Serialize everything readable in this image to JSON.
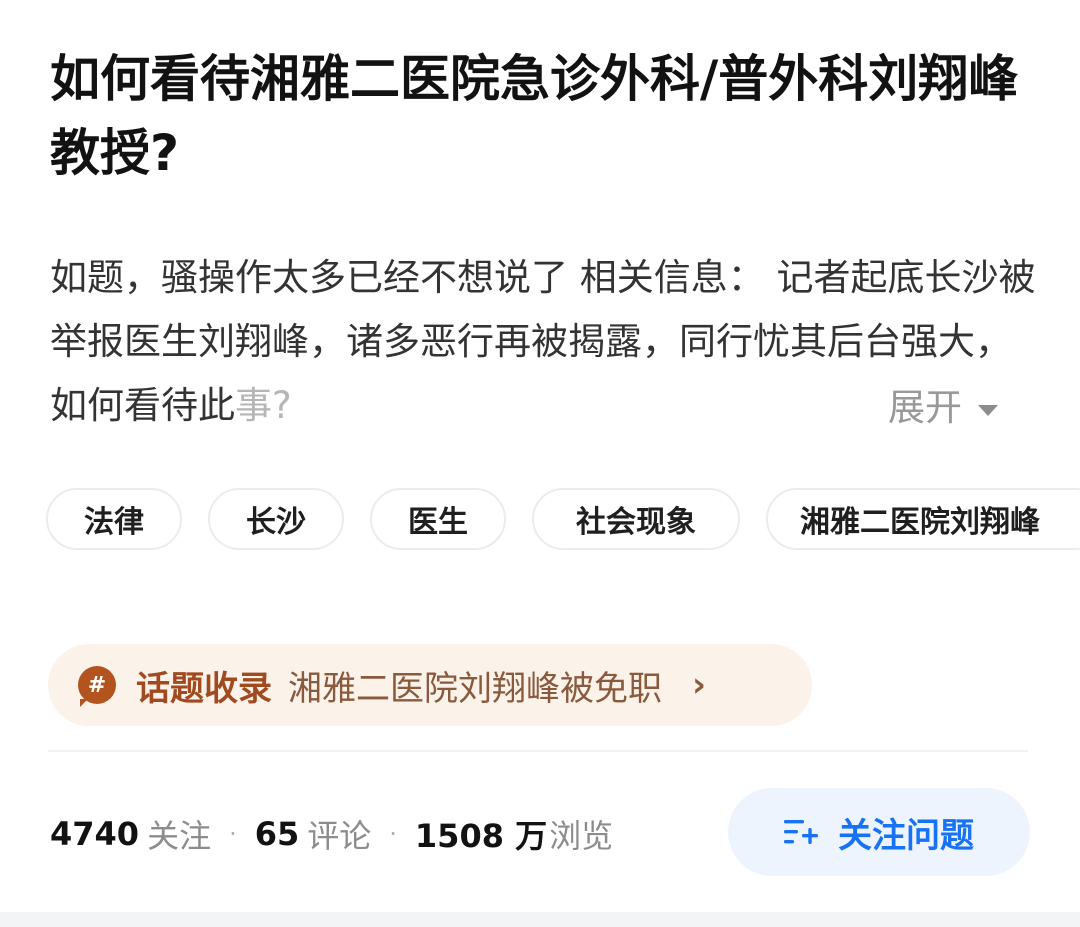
{
  "question": {
    "title": "如何看待湘雅二医院急诊外科/普外科刘翔峰教授?",
    "description": "如题，骚操作太多已经不想说了 相关信息： 记者起底长沙被举报医生刘翔峰，诸多恶行再被揭露，同行忧其后台强大，如何看待此",
    "description_fade": "事?",
    "expand_label": "展开"
  },
  "tags": [
    "法律",
    "长沙",
    "医生",
    "社会现象",
    "湘雅二医院刘翔峰"
  ],
  "topic": {
    "label": "话题收录",
    "name": "湘雅二医院刘翔峰被免职",
    "icon": "#"
  },
  "stats": {
    "followers": "4740",
    "followers_label": "关注",
    "comments": "65",
    "comments_label": "评论",
    "views": "1508 万",
    "views_label": "浏览"
  },
  "follow_button": {
    "label": "关注问题"
  },
  "colors": {
    "accent": "#1772f6",
    "topic_bg": "#fbf2ea",
    "topic_text": "#a14a1f"
  }
}
